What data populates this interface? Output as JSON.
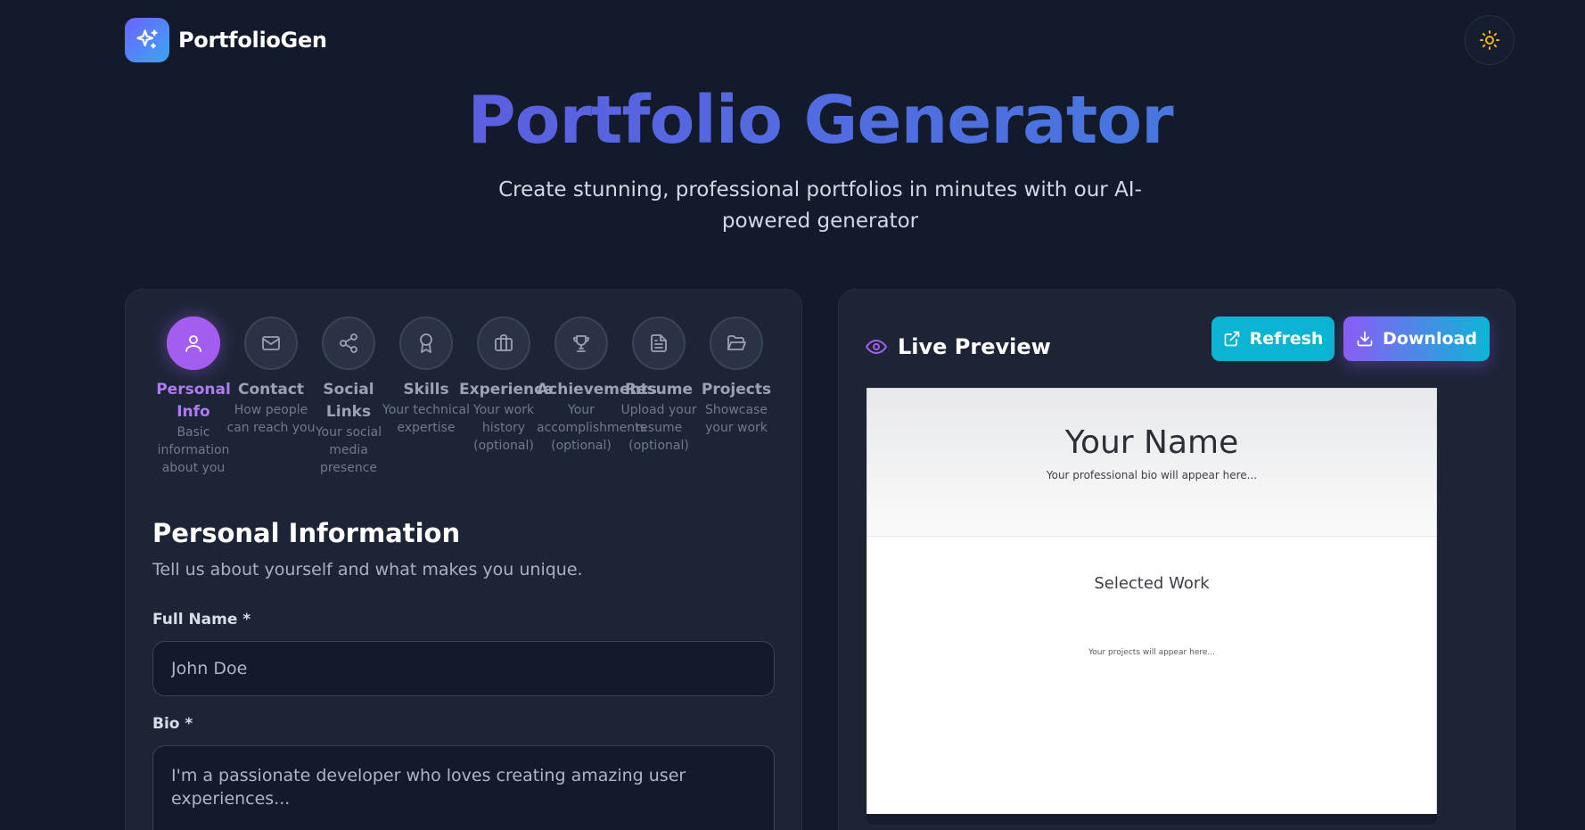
{
  "header": {
    "brand_name": "PortfolioGen",
    "logo_icon": "sparkles-icon",
    "theme_icon": "sun-icon"
  },
  "hero": {
    "title": "Portfolio Generator",
    "subtitle": "Create stunning, professional portfolios in minutes with our AI-powered generator"
  },
  "steps": [
    {
      "title": "Personal Info",
      "desc": "Basic information about you",
      "icon": "user-icon",
      "active": true
    },
    {
      "title": "Contact",
      "desc": "How people can reach you",
      "icon": "mail-icon",
      "active": false
    },
    {
      "title": "Social Links",
      "desc": "Your social media presence",
      "icon": "share-icon",
      "active": false
    },
    {
      "title": "Skills",
      "desc": "Your technical expertise",
      "icon": "award-icon",
      "active": false
    },
    {
      "title": "Experience",
      "desc": "Your work history (optional)",
      "icon": "briefcase-icon",
      "active": false
    },
    {
      "title": "Achievements",
      "desc": "Your accomplishments (optional)",
      "icon": "trophy-icon",
      "active": false
    },
    {
      "title": "Resume",
      "desc": "Upload your resume (optional)",
      "icon": "file-text-icon",
      "active": false
    },
    {
      "title": "Projects",
      "desc": "Showcase your work",
      "icon": "folder-open-icon",
      "active": false
    }
  ],
  "form": {
    "section_title": "Personal Information",
    "section_subtitle": "Tell us about yourself and what makes you unique.",
    "full_name_label": "Full Name *",
    "full_name_placeholder": "John Doe",
    "bio_label": "Bio *",
    "bio_placeholder": "I'm a passionate developer who loves creating amazing user experiences..."
  },
  "preview": {
    "title": "Live Preview",
    "refresh_label": "Refresh",
    "download_label": "Download",
    "name": "Your Name",
    "bio": "Your professional bio will appear here...",
    "section_heading": "Selected Work",
    "projects_placeholder": "Your projects will appear here..."
  },
  "colors": {
    "background": "#131a2b",
    "panel": "#1c2436",
    "accent_purple": "#a35ef0",
    "accent_cyan": "#0ab4d2"
  }
}
